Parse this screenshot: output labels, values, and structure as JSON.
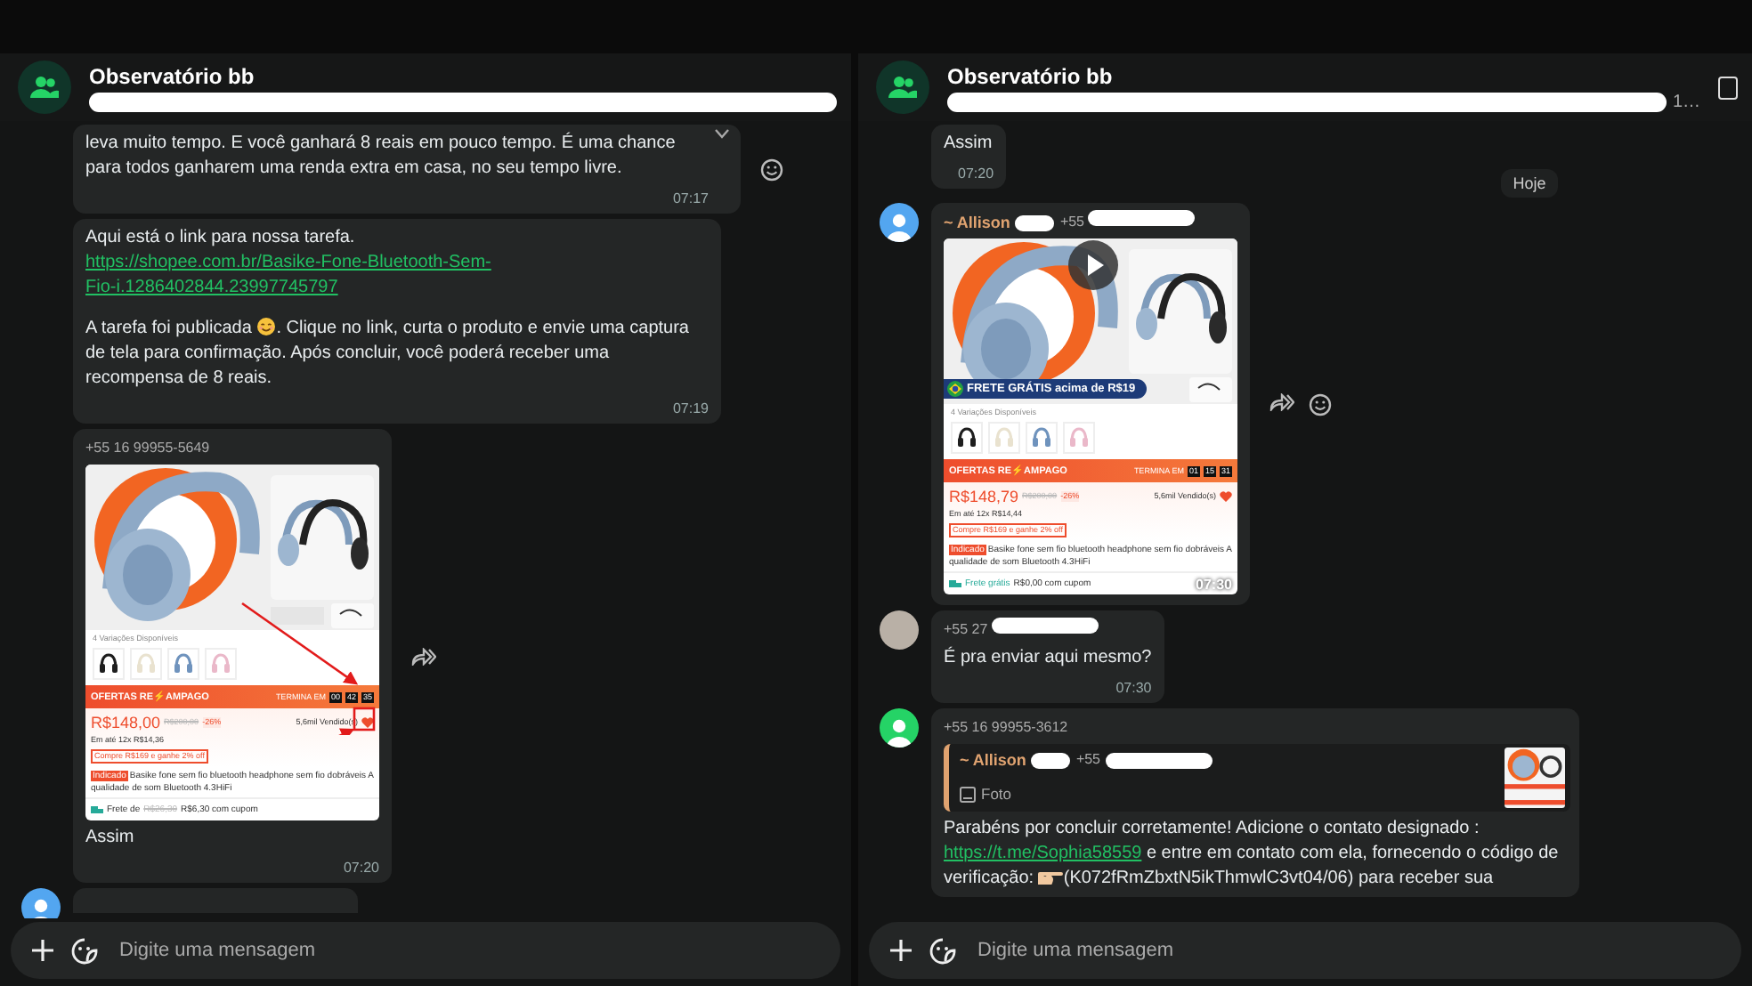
{
  "panels": [
    {
      "header": {
        "title": "Observatório bb",
        "square_icon": false
      },
      "messages": [
        {
          "kind": "text",
          "chevron": true,
          "actions": [
            {
              "kind": "emoji"
            }
          ],
          "paragraphs": [
            [
              {
                "kind": "text",
                "text": "leva muito tempo. E você ganhará 8 reais em pouco tempo. É uma chance para todos ganharem uma renda extra em casa, no seu tempo livre."
              }
            ]
          ],
          "time": "07:17"
        },
        {
          "kind": "text",
          "chevron": false,
          "paragraphs": [
            [
              {
                "kind": "text",
                "text": "Aqui está o link para nossa tarefa."
              },
              {
                "kind": "link",
                "text": "https://shopee.com.br/Basike-Fone-Bluetooth-Sem-Fio-i.1286402844.23997745797"
              }
            ],
            [
              {
                "kind": "text",
                "text": "A tarefa foi publicada "
              },
              {
                "kind": "smile"
              },
              {
                "kind": "text",
                "text": ". Clique no link, curta o produto e envie uma captura de tela para confirmação. Após concluir, você poderá receber uma recompensa de 8 reais."
              }
            ]
          ],
          "time": "07:19"
        },
        {
          "kind": "image",
          "actions": [
            {
              "kind": "forward"
            }
          ],
          "sender": {
            "phone": "+55 16 99955-5649",
            "redacted": false
          },
          "card": {
            "video": false,
            "annotated": true,
            "variants_label": "4 Variações Disponíveis",
            "variants": [
              {
                "color": "#1e1e1e"
              },
              {
                "color": "#e9e2cf"
              },
              {
                "color": "#6f93bd"
              },
              {
                "color": "#eab8c9"
              }
            ],
            "banner": "OFERTAS RE⚡AMPAGO",
            "ends_label": "TERMINA EM",
            "timer": [
              "00",
              "42",
              "35"
            ],
            "price": "R$148,00",
            "old_price": "R$200,00",
            "discount": "-26%",
            "installments": "Em até 12x R$14,36",
            "sold": "5,6mil Vendido(s)",
            "coupon": "Compre R$169 e ganhe 2% off",
            "tag": "Indicado",
            "title": "Basike fone sem fio bluetooth headphone sem fio dobráveis A qualidade de som Bluetooth 4.3HiFi",
            "shipping_label": "Frete de",
            "shipping_old": "R$26,30",
            "shipping_price": "R$6,30 com cupom"
          },
          "paragraphs": [
            [
              {
                "kind": "text",
                "text": "Assim"
              }
            ]
          ],
          "time": "07:20"
        },
        {
          "kind": "partial",
          "avatar": {
            "kind": "person",
            "color": "#53a6f0"
          }
        }
      ],
      "composer": {
        "placeholder": "Digite uma mensagem"
      }
    },
    {
      "header": {
        "title": "Observatório bb",
        "subtitle_tail": "1…",
        "square_icon": true
      },
      "messages": [
        {
          "kind": "text",
          "chevron": false,
          "paragraphs": [
            [
              {
                "kind": "text",
                "text": "Assim"
              }
            ]
          ],
          "time": "07:20"
        },
        {
          "kind": "date",
          "text": "Hoje"
        },
        {
          "kind": "image",
          "avatar": {
            "kind": "person",
            "color": "#53a6f0"
          },
          "actions": [
            {
              "kind": "forward"
            },
            {
              "kind": "emoji"
            }
          ],
          "sender": {
            "name": "~ Allison",
            "phone": "+55",
            "redacted": true
          },
          "card": {
            "video": true,
            "annotated": false,
            "promo": "FRETE GRÁTIS acima de R$19",
            "variants_label": "4 Variações Disponíveis",
            "variants": [
              {
                "color": "#1e1e1e"
              },
              {
                "color": "#e9e2cf"
              },
              {
                "color": "#6f93bd"
              },
              {
                "color": "#eab8c9"
              }
            ],
            "banner": "OFERTAS RE⚡AMPAGO",
            "ends_label": "TERMINA EM",
            "timer": [
              "01",
              "15",
              "31"
            ],
            "price": "R$148,79",
            "old_price": "R$200,00",
            "discount": "-26%",
            "installments": "Em até 12x R$14,44",
            "sold": "5,6mil Vendido(s)",
            "coupon": "Compre R$169 e ganhe 2% off",
            "tag": "Indicado",
            "title": "Basike fone sem fio bluetooth headphone sem fio dobráveis A qualidade de som Bluetooth 4.3HiFi",
            "shipping_label": "Frete grátis",
            "shipping_price": "R$0,00 com cupom",
            "time": "07:30"
          }
        },
        {
          "kind": "text",
          "chevron": false,
          "avatar": {
            "kind": "photo"
          },
          "sender": {
            "phone": "+55 27",
            "redacted": true
          },
          "paragraphs": [
            [
              {
                "kind": "text",
                "text": "É pra enviar aqui mesmo?"
              }
            ]
          ],
          "time": "07:30"
        },
        {
          "kind": "reply",
          "avatar": {
            "kind": "person",
            "color": "#25d366"
          },
          "sender": {
            "phone": "+55 16 99955-3612",
            "redacted": false
          },
          "quote": {
            "name": "~ Allison",
            "phone": "+55",
            "label": "Foto"
          },
          "paragraphs": [
            [
              {
                "kind": "text",
                "text": "Parabéns por concluir corretamente! Adicione o contato designado : "
              },
              {
                "kind": "link",
                "text": "https://t.me/Sophia58559"
              },
              {
                "kind": "text",
                "text": " e entre em contato com ela, fornecendo o código de verificação: "
              },
              {
                "kind": "pointing"
              },
              {
                "kind": "text",
                "text": "(K072fRmZbxtN5ikThmwlC3vt04/06) para receber sua"
              }
            ]
          ]
        }
      ],
      "composer": {
        "placeholder": "Digite uma mensagem"
      }
    }
  ]
}
